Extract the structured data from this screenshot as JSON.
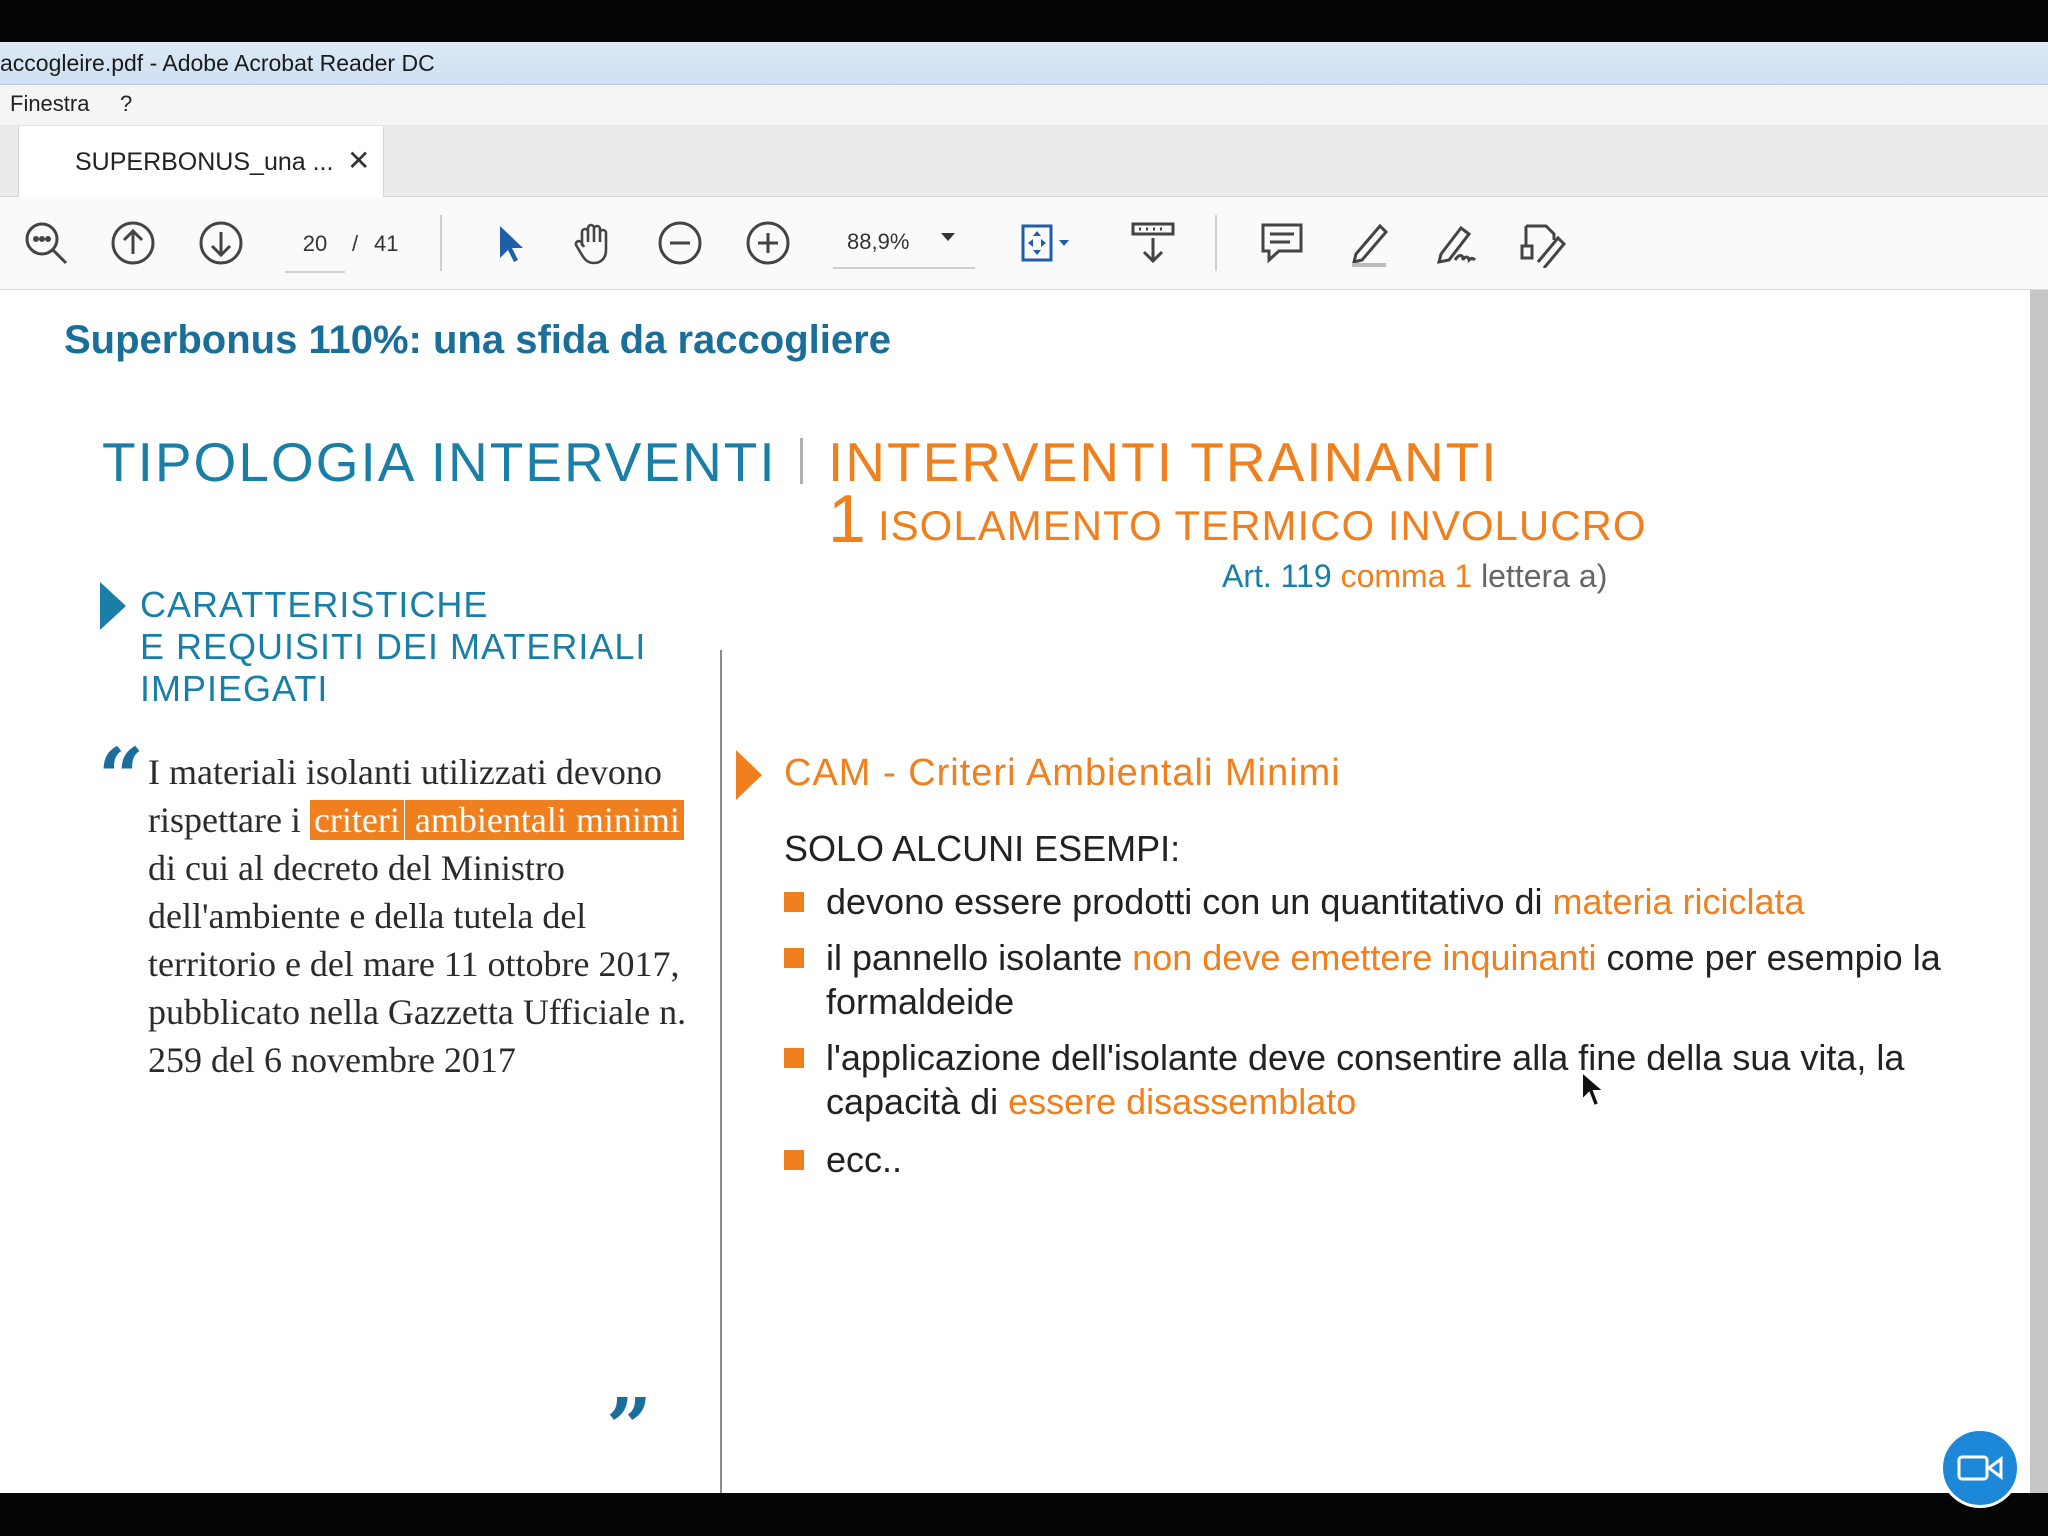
{
  "window": {
    "title": "accogleire.pdf - Adobe Acrobat Reader DC"
  },
  "menu": {
    "items": [
      "Finestra",
      "?"
    ]
  },
  "tab": {
    "label": "SUPERBONUS_una ...",
    "close_glyph": "✕"
  },
  "toolbar": {
    "current_page": "20",
    "page_separator": "/",
    "total_pages": "41",
    "zoom": "88,9%",
    "icons": [
      "zoom-search-icon",
      "page-up-icon",
      "page-down-icon",
      "select-arrow-icon",
      "hand-tool-icon",
      "zoom-out-icon",
      "zoom-in-icon",
      "fit-page-icon",
      "scroll-mode-icon",
      "comment-icon",
      "highlight-icon",
      "sign-icon",
      "edit-fill-icon"
    ]
  },
  "document": {
    "header": "Superbonus 110%: una sfida da raccogliere",
    "section_title": "TIPOLOGIA INTERVENTI",
    "main_title": "INTERVENTI TRAINANTI",
    "sub_number": "1",
    "sub_title": "ISOLAMENTO TERMICO INVOLUCRO",
    "article": {
      "art": "Art. 119",
      "comma": "comma 1",
      "lettera": "lettera a)"
    },
    "left_heading": [
      "CARATTERISTICHE",
      "E REQUISITI DEI MATERIALI",
      "IMPIEGATI"
    ],
    "quote": {
      "open": "“",
      "before": "I materiali isolanti utilizzati devono rispettare i",
      "highlight_1": "criteri",
      "highlight_2": "ambientali minimi",
      "after": "di cui al decreto del Ministro dell'ambiente e della tutela del territorio e del mare 11 ottobre 2017, pubblicato nella Gazzetta Ufficiale n. 259 del 6 novembre 2017",
      "close": "”"
    },
    "cam_title": "CAM - Criteri Ambientali Minimi",
    "examples_label": "SOLO ALCUNI ESEMPI:",
    "bullets": [
      {
        "before": "devono essere prodotti con un quantitativo di ",
        "highlight": "materia riciclata",
        "after": ""
      },
      {
        "before": "il pannello isolante ",
        "highlight": "non deve emettere inquinanti",
        "after": " come per esempio la formaldeide"
      },
      {
        "before": "l'applicazione dell'isolante deve consentire alla fine della sua vita, la capacità di ",
        "highlight": "essere disassemblato",
        "after": ""
      },
      {
        "before": "ecc..",
        "highlight": "",
        "after": ""
      }
    ]
  },
  "colors": {
    "accent_blue": "#1a7fa6",
    "accent_orange": "#f07f1e",
    "video_button": "#1e88d8"
  }
}
